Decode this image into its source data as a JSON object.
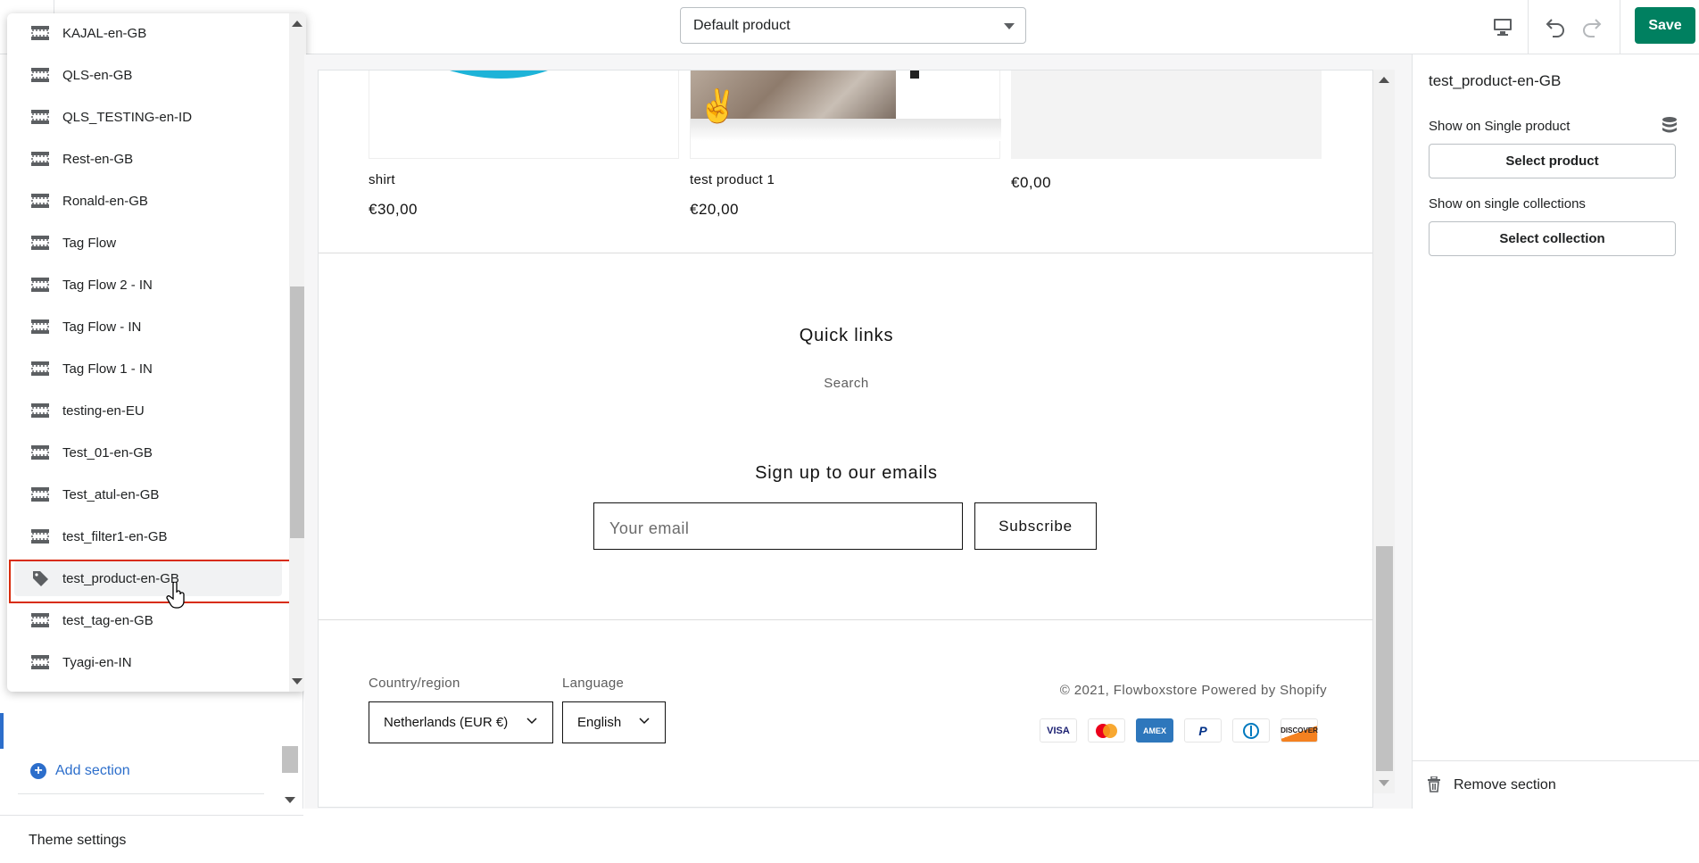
{
  "toolbar": {
    "template_select": "Default product",
    "save_label": "Save"
  },
  "section_dropdown": {
    "items": [
      {
        "label": "KAJAL-en-GB",
        "icon": "section-layout-icon"
      },
      {
        "label": "QLS-en-GB",
        "icon": "section-layout-icon"
      },
      {
        "label": "QLS_TESTING-en-ID",
        "icon": "section-layout-icon"
      },
      {
        "label": "Rest-en-GB",
        "icon": "section-layout-icon"
      },
      {
        "label": "Ronald-en-GB",
        "icon": "section-layout-icon"
      },
      {
        "label": "Tag Flow",
        "icon": "section-layout-icon"
      },
      {
        "label": "Tag Flow 2 - IN",
        "icon": "section-layout-icon"
      },
      {
        "label": "Tag Flow - IN",
        "icon": "section-layout-icon"
      },
      {
        "label": "Tag Flow 1 - IN",
        "icon": "section-layout-icon"
      },
      {
        "label": "testing-en-EU",
        "icon": "section-layout-icon"
      },
      {
        "label": "Test_01-en-GB",
        "icon": "section-layout-icon"
      },
      {
        "label": "Test_atul-en-GB",
        "icon": "section-layout-icon"
      },
      {
        "label": "test_filter1-en-GB",
        "icon": "section-layout-icon"
      },
      {
        "label": "test_product-en-GB",
        "icon": "tag-icon"
      },
      {
        "label": "test_tag-en-GB",
        "icon": "section-layout-icon"
      },
      {
        "label": "Tyagi-en-IN",
        "icon": "section-layout-icon"
      }
    ]
  },
  "left_panel": {
    "add_section_label": "Add section",
    "theme_settings_label": "Theme settings"
  },
  "preview": {
    "products": [
      {
        "name": "shirt",
        "price": "€30,00"
      },
      {
        "name": "test product 1",
        "price": "€20,00"
      },
      {
        "name": "",
        "price": "€0,00"
      }
    ],
    "quick_links_heading": "Quick links",
    "quick_links": [
      "Search"
    ],
    "newsletter_heading": "Sign up to our emails",
    "email_placeholder": "Your email",
    "subscribe_label": "Subscribe",
    "country_label": "Country/region",
    "country_value": "Netherlands (EUR €)",
    "language_label": "Language",
    "language_value": "English",
    "copyright": "© 2021, Flowboxstore Powered by Shopify",
    "payment_icons": [
      "VISA",
      "mastercard",
      "AMEX",
      "PayPal",
      "Diners",
      "DISCOVER"
    ]
  },
  "right_panel": {
    "title": "test_product-en-GB",
    "single_product_label": "Show on Single product",
    "select_product_label": "Select product",
    "single_collections_label": "Show on single collections",
    "select_collection_label": "Select collection",
    "remove_section_label": "Remove section"
  },
  "colors": {
    "save_green": "#008060",
    "link_blue": "#2c6ecb",
    "highlight_red": "#d82c0d"
  }
}
